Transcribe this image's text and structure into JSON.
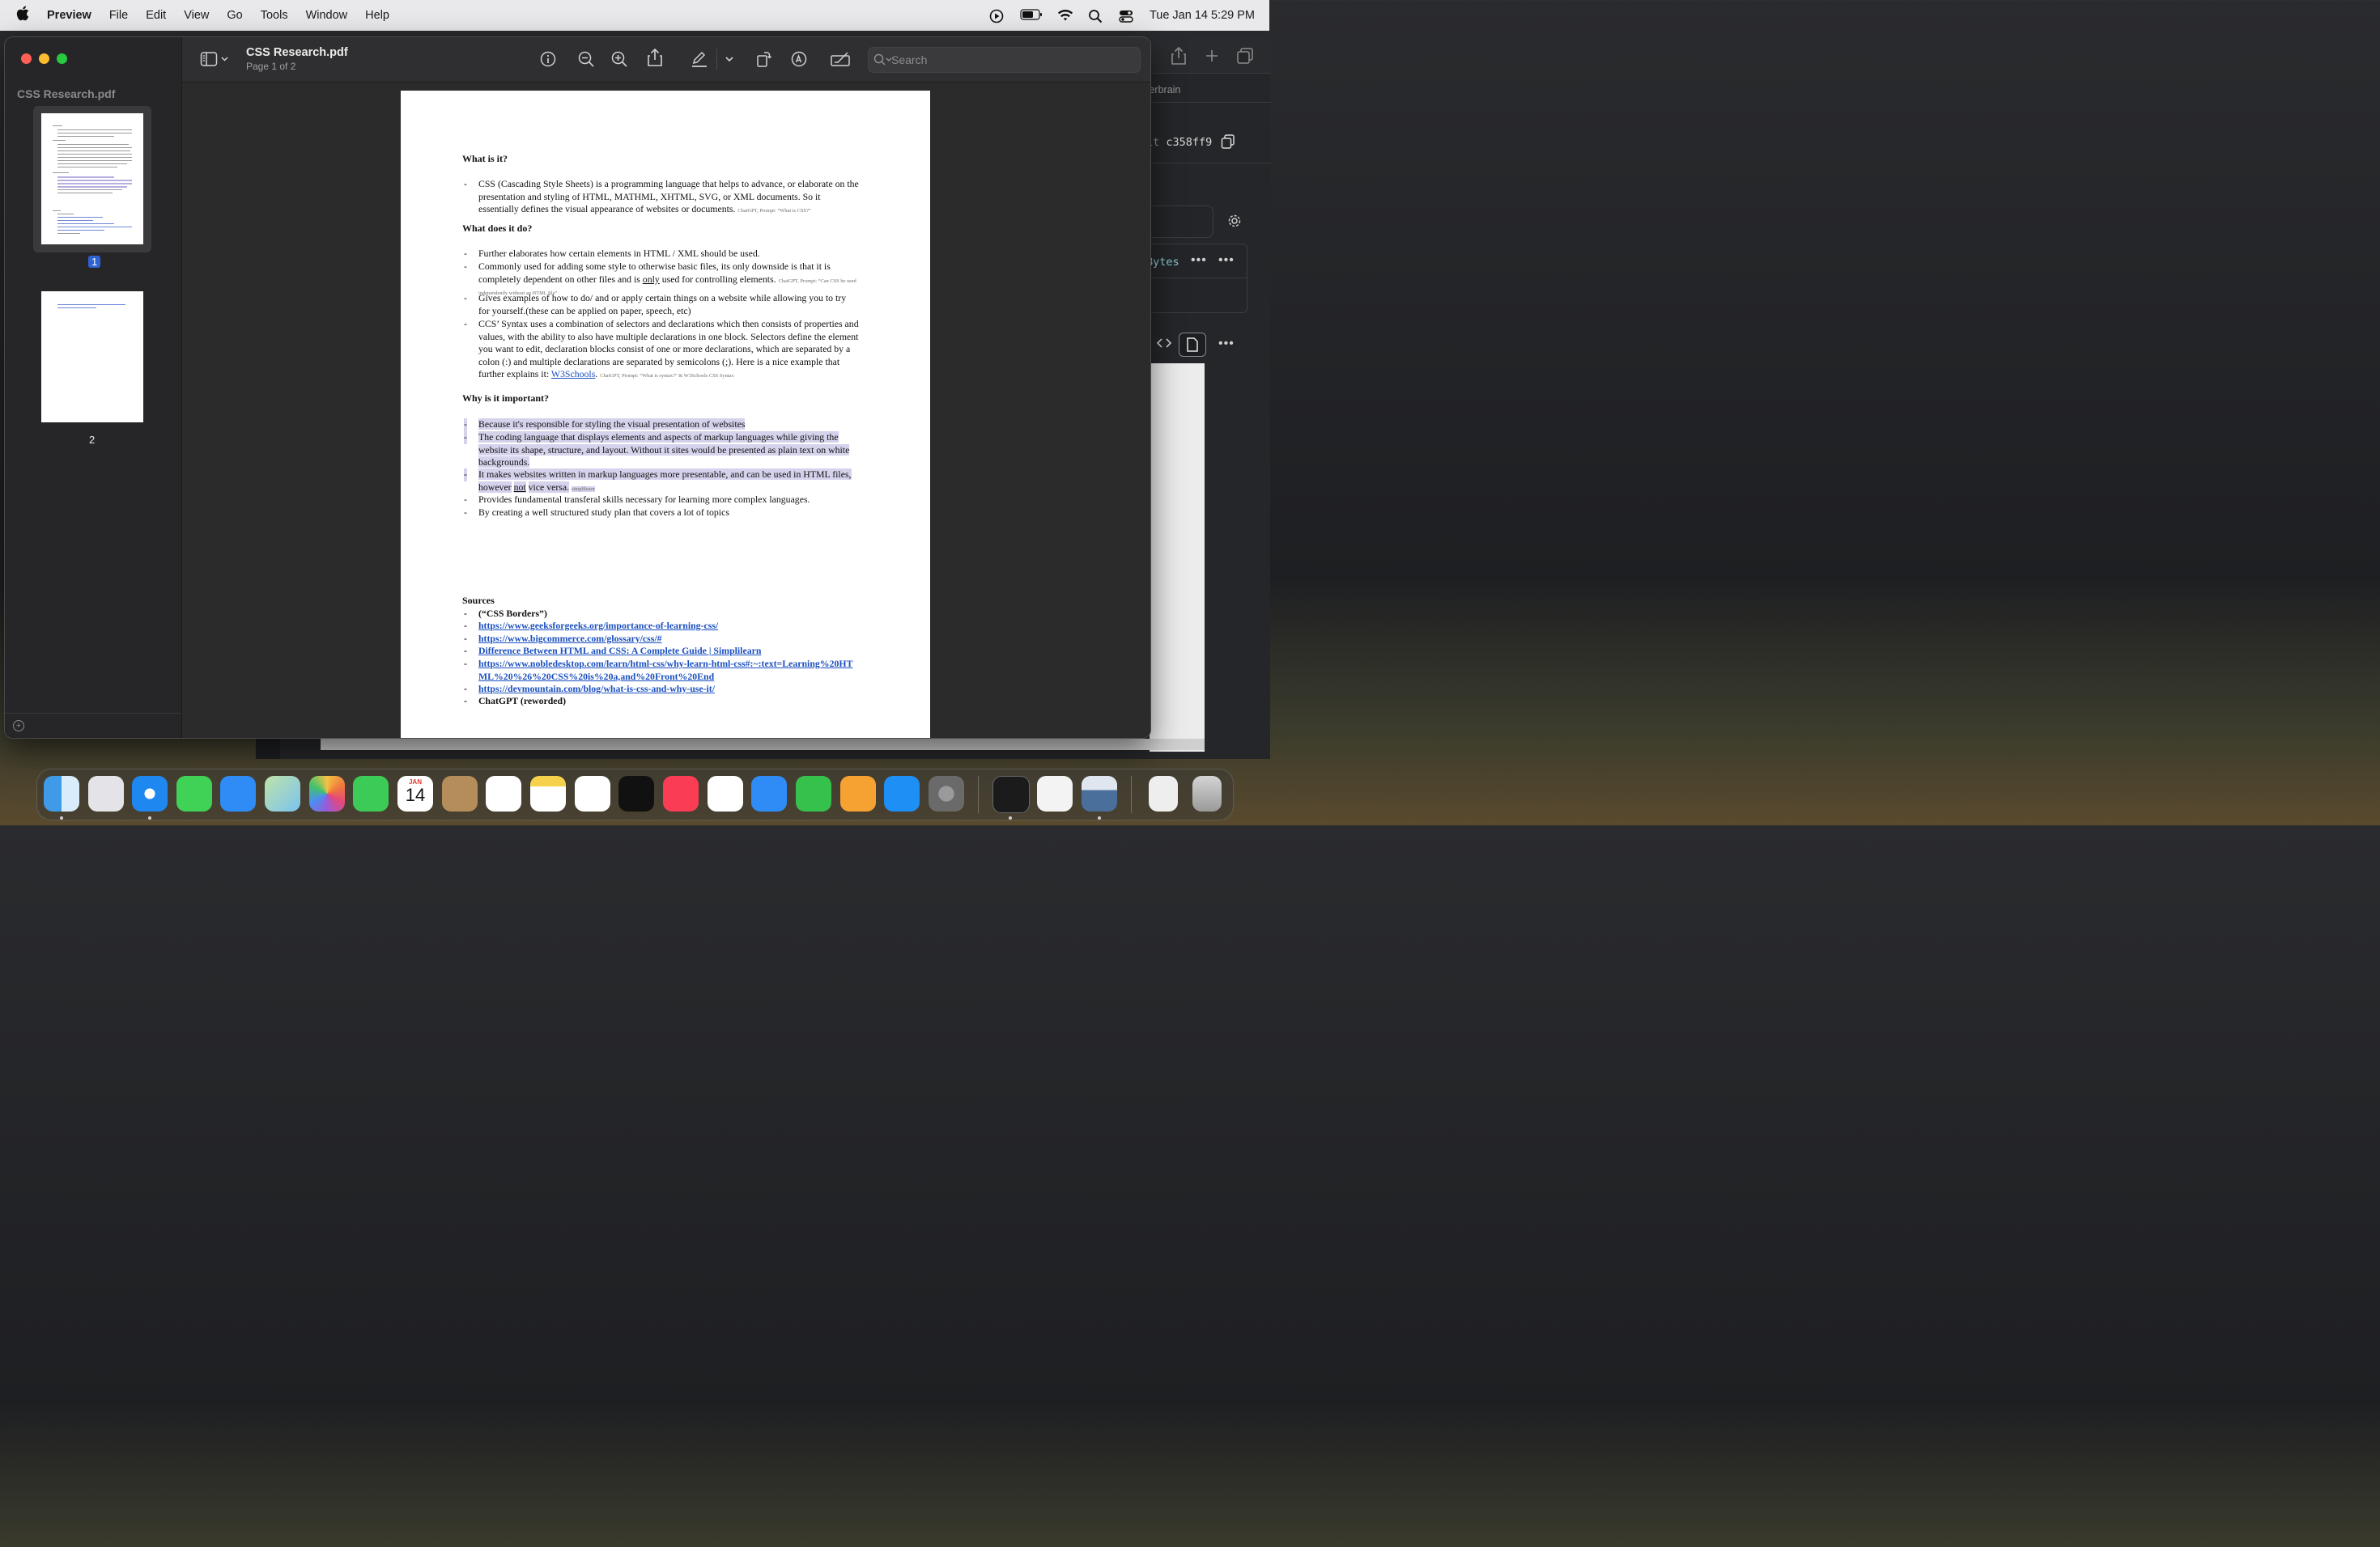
{
  "menubar": {
    "apple": "",
    "app_name": "Preview",
    "items": [
      "File",
      "Edit",
      "View",
      "Go",
      "Tools",
      "Window",
      "Help"
    ],
    "clock": "Tue Jan 14  5:29 PM"
  },
  "background_window": {
    "tab_label": "terbrain",
    "commit_prefix": "it",
    "commit_hash": "c358ff9",
    "bytes_label": "Bytes"
  },
  "preview": {
    "sidebar_title": "CSS Research.pdf",
    "page_labels": [
      "1",
      "2"
    ],
    "doc_title": "CSS Research.pdf",
    "doc_subtitle": "Page 1 of 2",
    "search_placeholder": "Search"
  },
  "pdf": {
    "h_what": "What is it?",
    "what_1": "CSS (Cascading Style Sheets) is a programming language that helps to advance, or elaborate on the presentation and styling of HTML, MATHML, XHTML, SVG, or XML documents. So it essentially defines the visual appearance of websites or documents.",
    "what_1_cite": "ChatGPT, Prompt: “What is CSS?”",
    "h_does": "What does it do?",
    "does_1": "Further elaborates how certain elements in HTML / XML should be used.",
    "does_2a": "Commonly used for adding some style to otherwise basic files, its only downside is that it is completely dependent on other files and is",
    "does_2_only": "only",
    "does_2b": "used for controlling elements.",
    "does_2_cite": "ChatGPT, Prompt: “Can CSS be used independently without an HTML file”",
    "does_3": "Gives examples of how to do/ and or apply certain things on a website while allowing you to try for yourself.(these can be applied on paper, speech, etc)",
    "does_4": "CCS’ Syntax uses a combination of selectors and declarations which then consists of properties and values, with the ability to also have multiple declarations in one block. Selectors define the element you want to edit, declaration blocks consist of one or more declarations, which are separated by a colon (:) and multiple declarations are separated by semicolons (;). Here is a nice example that further explains it:",
    "does_4_link": "W3Schools",
    "does_4_cite": "ChatGPT, Prompt: “What is syntax?” & W3Schools CSS Syntax",
    "h_why": "Why is it important?",
    "why_1": "Because it's responsible for styling the visual presentation of websites",
    "why_2": "The coding language that displays elements and aspects of markup languages while giving the website its shape, structure, and layout. Without it sites would be presented as plain text on white backgrounds.",
    "why_3a": "It makes websites written in markup languages more presentable, and can be used in HTML files, however",
    "why_3_not": "not",
    "why_3b": "vice versa.",
    "why_3_cite": "simplilearn",
    "why_4": "Provides fundamental transferal skills necessary for learning more complex languages.",
    "why_5": "By creating a well structured study plan that covers a lot of topics",
    "h_sources": "Sources",
    "sources": [
      "(“CSS Borders”)",
      "https://www.geeksforgeeks.org/importance-of-learning-css/",
      "https://www.bigcommerce.com/glossary/css/#",
      "Difference Between HTML and CSS: A Complete Guide | Simplilearn",
      "https://www.nobledesktop.com/learn/html-css/why-learn-html-css#:~:text=Learning%20HTML%20%26%20CSS%20is%20a,and%20Front%20End",
      "https://devmountain.com/blog/what-is-css-and-why-use-it/",
      "ChatGPT (reworded)"
    ]
  },
  "dock": {
    "calendar_month": "JAN",
    "calendar_day": "14",
    "apps": [
      "finder-icon",
      "launchpad-icon",
      "safari-icon",
      "messages-icon",
      "mail-icon",
      "maps-icon",
      "photos-icon",
      "facetime-icon",
      "calendar-icon",
      "contacts-icon",
      "reminders-icon",
      "notes-icon",
      "freeform-icon",
      "tv-icon",
      "music-icon",
      "news-icon",
      "keynote-icon",
      "numbers-icon",
      "pages-icon",
      "app-store-icon",
      "system-settings-icon",
      "terminal-icon",
      "textedit-icon",
      "preview-icon",
      "documents-icon",
      "trash-icon"
    ]
  },
  "colors": {
    "highlight": "#d5d2ec",
    "link": "#1a4fbf",
    "selection": "#2f62d3"
  }
}
